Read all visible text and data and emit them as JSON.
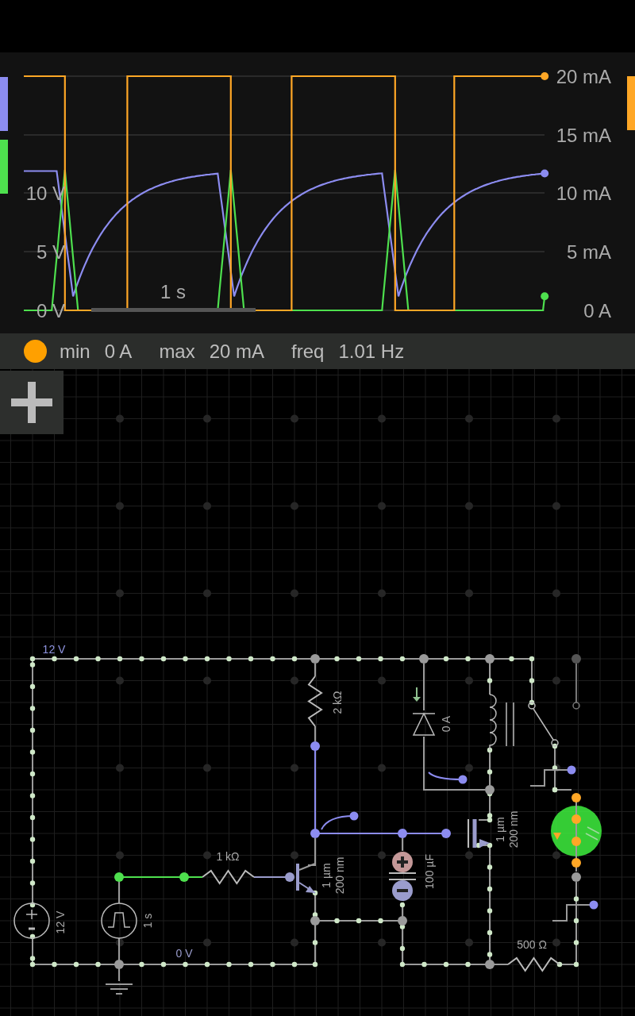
{
  "scope": {
    "traces": [
      {
        "color": "#8c8cf0"
      },
      {
        "color": "#4ee04e"
      },
      {
        "color": "#ffa726"
      }
    ],
    "left_ticks": [
      "10 V",
      "5 V",
      "0 V"
    ],
    "right_ticks": [
      "20 mA",
      "15 mA",
      "10 mA",
      "5 mA",
      "0 A"
    ],
    "scale_bar": "1 s"
  },
  "readout": [
    {
      "label": "min",
      "value": "0 A"
    },
    {
      "label": "max",
      "value": "20 mA"
    },
    {
      "label": "freq",
      "value": "1.01 Hz"
    }
  ],
  "circuit": {
    "labels": [
      "12 V",
      "12 V",
      "1 s",
      "0 V",
      "1 kΩ",
      "2 kΩ",
      "0 A",
      "1 µm",
      "200 nm",
      "100 µF",
      "1 µm",
      "200 nm",
      "500 Ω"
    ]
  }
}
